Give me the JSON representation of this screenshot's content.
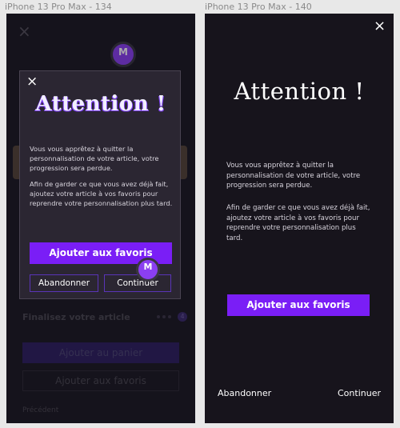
{
  "frames": {
    "left": {
      "label": "iPhone 13 Pro Max - 134"
    },
    "right": {
      "label": "iPhone 13 Pro Max - 140"
    }
  },
  "left_screen": {
    "background": {
      "close_glyph": "×",
      "avatar_initial": "M",
      "finalize_label": "Finalisez votre article",
      "progress_badge": "4",
      "add_to_cart_label": "Ajouter au panier",
      "add_to_favorites_label": "Ajouter aux favoris",
      "previous_label": "Précédent"
    },
    "modal": {
      "close_glyph": "×",
      "title": "Attention !",
      "paragraph1": "Vous vous apprêtez à quitter la personnalisation de votre article, votre progression sera perdue.",
      "paragraph2": "Afin de garder ce que vous avez déjà fait, ajoutez votre article à vos favoris pour reprendre votre personnalisation plus tard.",
      "favorites_button": "Ajouter aux favoris",
      "abandon_button": "Abandonner",
      "continue_button": "Continuer",
      "avatar_initial": "M"
    }
  },
  "right_screen": {
    "close_glyph": "×",
    "title": "Attention !",
    "paragraph1": "Vous vous apprêtez à quitter la personnalisation de votre article, votre progression sera perdue.",
    "paragraph2": "Afin de garder ce que vous avez déjà fait, ajoutez votre article à vos favoris pour reprendre votre personnalisation plus tard.",
    "favorites_button": "Ajouter aux favoris",
    "abandon_button": "Abandonner",
    "continue_button": "Continuer"
  },
  "colors": {
    "accent": "#7a1ef6",
    "avatar": "#8b3ff1",
    "screen_bg": "#17141c",
    "modal_bg": "#2b2632"
  },
  "icons": {
    "close": "close-icon",
    "avatar": "avatar"
  }
}
